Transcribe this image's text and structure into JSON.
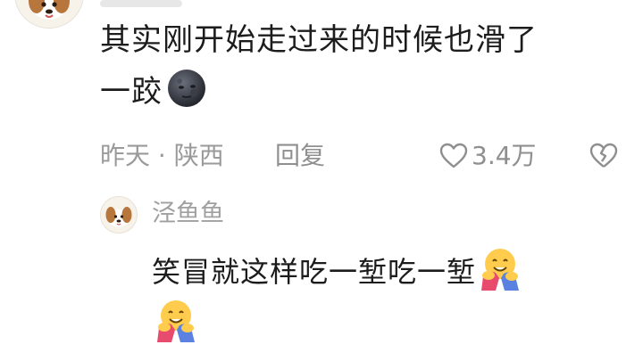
{
  "comment": {
    "line1": "其实刚开始走过来的时候也滑了",
    "line2": "一跤",
    "emoji": "new-moon-face-icon",
    "time": "昨天",
    "separator": "·",
    "location": "陕西",
    "reply_label": "回复",
    "likes": "3.4万"
  },
  "reply": {
    "author": "泾鱼鱼",
    "text_line1": "笑冒就这样吃一堑吃一堑",
    "emoji": "hugging-face-icon"
  },
  "colors": {
    "text": "#1c1c1c",
    "meta": "#9a9a9a",
    "background": "#ffffff"
  }
}
